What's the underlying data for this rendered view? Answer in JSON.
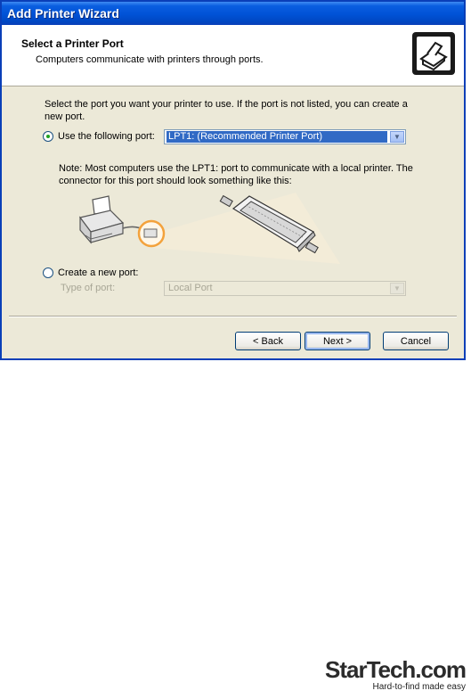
{
  "window": {
    "title": "Add Printer Wizard"
  },
  "header": {
    "title": "Select a Printer Port",
    "subtitle": "Computers communicate with printers through ports."
  },
  "content": {
    "instructions": "Select the port you want your printer to use.  If the port is not listed, you can create a new port.",
    "use_port": {
      "label": "Use the following port:",
      "selected": true,
      "value": "LPT1: (Recommended Printer Port)"
    },
    "note": "Note: Most computers use the LPT1: port to communicate with a local printer. The connector for this port should look something like this:",
    "create_port": {
      "label": "Create a new port:",
      "selected": false,
      "type_label": "Type of port:",
      "type_value": "Local Port"
    }
  },
  "buttons": {
    "back": "< Back",
    "next": "Next >",
    "cancel": "Cancel"
  },
  "branding": {
    "name": "StarTech.com",
    "tagline": "Hard-to-find made easy"
  }
}
